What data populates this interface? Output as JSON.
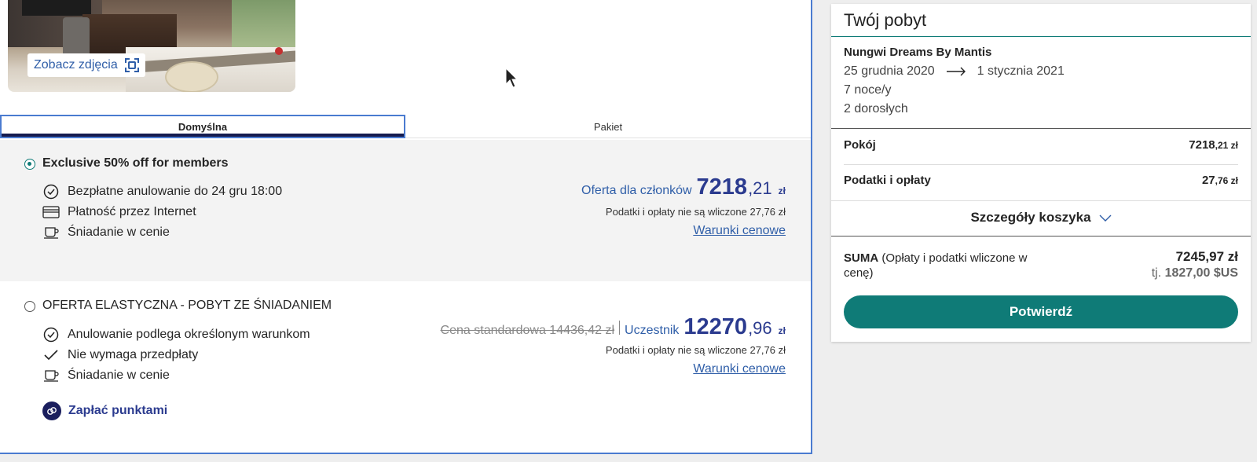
{
  "photo": {
    "see_photos_label": "Zobacz zdjęcia"
  },
  "tabs": [
    {
      "label": "Domyślna",
      "active": true
    },
    {
      "label": "Pakiet",
      "active": false
    }
  ],
  "offers": [
    {
      "title": "Exclusive 50% off for members",
      "selected": true,
      "features": [
        {
          "icon": "clock-check-icon",
          "text": "Bezpłatne anulowanie do 24 gru 18:00"
        },
        {
          "icon": "credit-card-icon",
          "text": "Płatność przez Internet"
        },
        {
          "icon": "coffee-cup-icon",
          "text": "Śniadanie w cenie"
        }
      ],
      "price_label": "Oferta dla członków",
      "price_whole": "7218",
      "price_decimal": ",21",
      "currency": "zł",
      "tax_note": "Podatki i opłaty nie są wliczone 27,76 zł",
      "conditions_link": "Warunki cenowe"
    },
    {
      "title": "OFERTA ELASTYCZNA - POBYT ZE ŚNIADANIEM",
      "selected": false,
      "features": [
        {
          "icon": "clock-check-icon",
          "text": "Anulowanie podlega określonym warunkom"
        },
        {
          "icon": "checkmark-icon",
          "text": "Nie wymaga przedpłaty"
        },
        {
          "icon": "coffee-cup-icon",
          "text": "Śniadanie w cenie"
        }
      ],
      "standard_price": "Cena standardowa 14436,42 zł",
      "price_label": "Uczestnik",
      "price_whole": "12270",
      "price_decimal": ",96",
      "currency": "zł",
      "tax_note": "Podatki i opłaty nie są wliczone 27,76 zł",
      "conditions_link": "Warunki cenowe",
      "points_label": "Zapłać punktami"
    }
  ],
  "summary": {
    "title": "Twój pobyt",
    "hotel": "Nungwi Dreams By Mantis",
    "checkin": "25 grudnia 2020",
    "checkout": "1 stycznia 2021",
    "nights": "7 noce/y",
    "guests": "2 dorosłych",
    "room_label": "Pokój",
    "room_whole": "7218",
    "room_decimal": ",21 zł",
    "taxes_label": "Podatki i opłaty",
    "taxes_whole": "27",
    "taxes_decimal": ",76 zł",
    "cart_details": "Szczegóły koszyka",
    "total_label_bold": "SUMA",
    "total_label_rest": "(Opłaty i podatki wliczone w cenę)",
    "total_value": "7245,97 zł",
    "total_usd_prefix": "tj.",
    "total_usd": "1827,00 $US",
    "confirm_label": "Potwierdź"
  },
  "colors": {
    "accent": "#0f7b77",
    "link": "#2f5ea8",
    "price": "#2b3b8f",
    "tab_border": "#4a7bd0"
  }
}
